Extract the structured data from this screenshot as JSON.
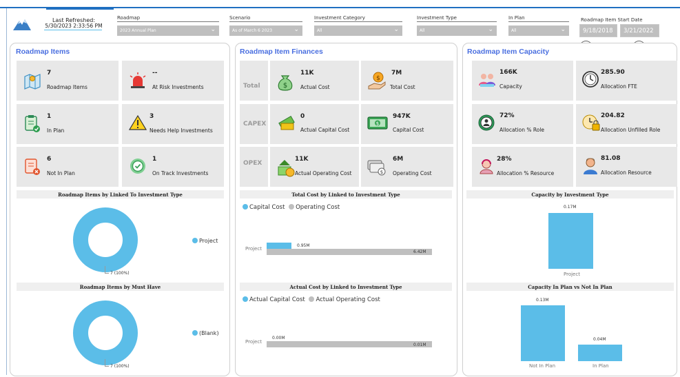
{
  "header": {
    "refresh_label": "Last Refreshed:",
    "refresh_value": "5/30/2023 2:33:56 PM",
    "filters": [
      {
        "label": "Roadmap",
        "value": "2023 Annual Plan"
      },
      {
        "label": "Scenario",
        "value": "As of March 6 2023"
      },
      {
        "label": "Investment Category",
        "value": "All"
      },
      {
        "label": "Investment Type",
        "value": "All"
      },
      {
        "label": "In Plan",
        "value": "All"
      }
    ],
    "date_filter": {
      "label": "Roadmap Item Start Date",
      "start": "9/18/2018",
      "end": "3/21/2022"
    }
  },
  "items_panel": {
    "title": "Roadmap Items",
    "cards": [
      {
        "value": "7",
        "label": "Roadmap Items",
        "icon": "map-icon"
      },
      {
        "value": "--",
        "label": "At Risk Investments",
        "icon": "siren-icon"
      },
      {
        "value": "1",
        "label": "In Plan",
        "icon": "clipboard-check-icon"
      },
      {
        "value": "3",
        "label": "Needs Help Investments",
        "icon": "warning-icon"
      },
      {
        "value": "6",
        "label": "Not In Plan",
        "icon": "list-x-icon"
      },
      {
        "value": "1",
        "label": "On Track Investments",
        "icon": "check-circle-icon"
      }
    ],
    "chart1": {
      "title": "Roadmap Items by Linked To Investment Type",
      "legend": "Project",
      "label": "7 (100%)"
    },
    "chart2": {
      "title": "Roadmap Items by Must Have",
      "legend": "(Blank)",
      "label": "7 (100%)"
    }
  },
  "finance_panel": {
    "title": "Roadmap Item Finances",
    "rows": [
      {
        "name": "Total",
        "cards": [
          {
            "value": "11K",
            "label": "Actual Cost"
          },
          {
            "value": "7M",
            "label": "Total Cost"
          }
        ]
      },
      {
        "name": "CAPEX",
        "cards": [
          {
            "value": "0",
            "label": "Actual Capital Cost"
          },
          {
            "value": "947K",
            "label": "Capital Cost"
          }
        ]
      },
      {
        "name": "OPEX",
        "cards": [
          {
            "value": "11K",
            "label": "Actual Operating Cost"
          },
          {
            "value": "6M",
            "label": "Operating Cost"
          }
        ]
      }
    ],
    "chart1": {
      "title": "Total Cost by Linked to Investment Type",
      "legend": [
        "Capital Cost",
        "Operating Cost"
      ],
      "category": "Project",
      "labels": [
        "0.95M",
        "6.42M"
      ]
    },
    "chart2": {
      "title": "Actual Cost by Linked to Investment Type",
      "legend": [
        "Actual Capital Cost",
        "Actual Operating Cost"
      ],
      "category": "Project",
      "labels": [
        "0.00M",
        "0.01M"
      ]
    }
  },
  "capacity_panel": {
    "title": "Roadmap Item Capacity",
    "cards": [
      {
        "value": "166K",
        "label": "Capacity"
      },
      {
        "value": "285.90",
        "label": "Allocation FTE"
      },
      {
        "value": "72%",
        "label": "Allocation % Role"
      },
      {
        "value": "204.82",
        "label": "Allocation Unfilled Role"
      },
      {
        "value": "28%",
        "label": "Allocation % Resource"
      },
      {
        "value": "81.08",
        "label": "Allocation Resource"
      }
    ],
    "chart1": {
      "title": "Capacity by Investment Type",
      "category": "Project",
      "label": "0.17M"
    },
    "chart2": {
      "title": "Capacity In Plan vs Not In Plan",
      "categories": [
        "Not In Plan",
        "In Plan"
      ],
      "labels": [
        "0.13M",
        "0.04M"
      ]
    }
  },
  "colors": {
    "accent": "#4a6fe0",
    "bar_blue": "#5bbde8",
    "bar_grey": "#bfbfbf",
    "card_bg": "#e8e8e8",
    "nav_blue": "#1f6fc1"
  },
  "chart_data": [
    {
      "type": "pie",
      "title": "Roadmap Items by Linked To Investment Type",
      "categories": [
        "Project"
      ],
      "values": [
        7
      ]
    },
    {
      "type": "pie",
      "title": "Roadmap Items by Must Have",
      "categories": [
        "(Blank)"
      ],
      "values": [
        7
      ]
    },
    {
      "type": "bar",
      "title": "Total Cost by Linked to Investment Type",
      "categories": [
        "Project"
      ],
      "series": [
        {
          "name": "Capital Cost",
          "values": [
            0.95
          ]
        },
        {
          "name": "Operating Cost",
          "values": [
            6.42
          ]
        }
      ]
    },
    {
      "type": "bar",
      "title": "Actual Cost by Linked to Investment Type",
      "categories": [
        "Project"
      ],
      "series": [
        {
          "name": "Actual Capital Cost",
          "values": [
            0.0
          ]
        },
        {
          "name": "Actual Operating Cost",
          "values": [
            0.01
          ]
        }
      ]
    },
    {
      "type": "bar",
      "title": "Capacity by Investment Type",
      "categories": [
        "Project"
      ],
      "values": [
        0.17
      ]
    },
    {
      "type": "bar",
      "title": "Capacity In Plan vs Not In Plan",
      "categories": [
        "Not In Plan",
        "In Plan"
      ],
      "values": [
        0.13,
        0.04
      ]
    }
  ]
}
